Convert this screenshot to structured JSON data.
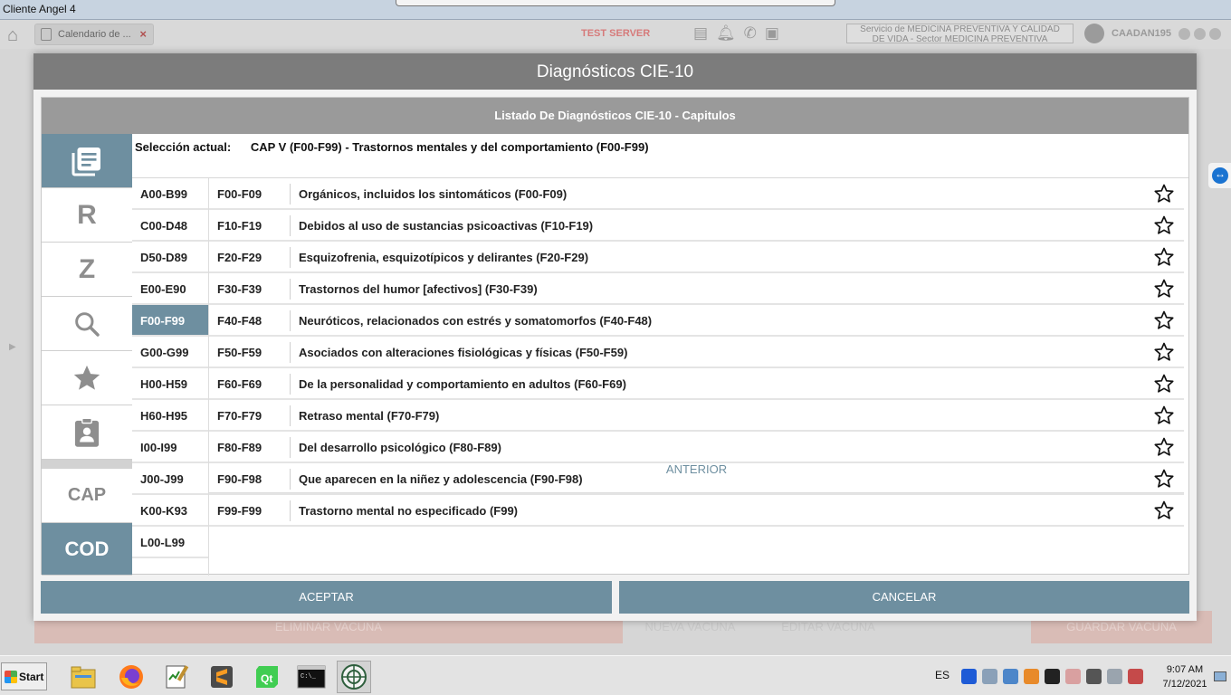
{
  "window": {
    "title": "Cliente Angel 4"
  },
  "app": {
    "tab_label": "Calendario de ...",
    "tab_close": "×",
    "server_label": "TEST SERVER",
    "service_line1": "Servicio de MEDICINA PREVENTIVA Y CALIDAD",
    "service_line2": "DE VIDA - Sector MEDICINA PREVENTIVA",
    "user": "CAADAN195",
    "bg_buttons": {
      "eliminar": "ELIMINAR VACUNA",
      "nueva": "NUEVA VACUNA",
      "editar": "EDITAR VACUNA",
      "guardar": "GUARDAR VACUNA"
    }
  },
  "dialog": {
    "title": "Diagnósticos CIE-10",
    "panel_title": "Listado De Diagnósticos CIE-10 - Capitulos",
    "selection_label": "Selección actual:",
    "selection_value": "CAP V (F00-F99) - Trastornos mentales y del comportamiento (F00-F99)",
    "side_buttons": {
      "r": "R",
      "z": "Z",
      "cap": "CAP",
      "cod": "COD"
    },
    "ranges": [
      "A00-B99",
      "C00-D48",
      "D50-D89",
      "E00-E90",
      "F00-F99",
      "G00-G99",
      "H00-H59",
      "H60-H95",
      "I00-I99",
      "J00-J99",
      "K00-K93",
      "L00-L99"
    ],
    "active_range": "F00-F99",
    "subgroups": [
      {
        "code": "F00-F09",
        "desc": "Orgánicos, incluidos los sintomáticos (F00-F09)"
      },
      {
        "code": "F10-F19",
        "desc": "Debidos al uso de sustancias psicoactivas (F10-F19)"
      },
      {
        "code": "F20-F29",
        "desc": "Esquizofrenia, esquizotípicos y delirantes (F20-F29)"
      },
      {
        "code": "F30-F39",
        "desc": "Trastornos del humor [afectivos] (F30-F39)"
      },
      {
        "code": "F40-F48",
        "desc": "Neuróticos, relacionados con estrés y somatomorfos (F40-F48)"
      },
      {
        "code": "F50-F59",
        "desc": "Asociados con alteraciones fisiológicas y físicas (F50-F59)"
      },
      {
        "code": "F60-F69",
        "desc": "De la personalidad y comportamiento en adultos (F60-F69)"
      },
      {
        "code": "F70-F79",
        "desc": "Retraso mental (F70-F79)"
      },
      {
        "code": "F80-F89",
        "desc": "Del desarrollo psicológico (F80-F89)"
      },
      {
        "code": "F90-F98",
        "desc": "Que aparecen en la niñez y adolescencia (F90-F98)"
      },
      {
        "code": "F99-F99",
        "desc": "Trastorno mental no especificado (F99)"
      }
    ],
    "anterior": "ANTERIOR",
    "accept": "ACEPTAR",
    "cancel": "CANCELAR"
  },
  "taskbar": {
    "start": "Start",
    "lang": "ES",
    "time": "9:07 AM",
    "date": "7/12/2021"
  },
  "colors": {
    "accent": "#6e8fa0",
    "title_bar": "#7c7c7c",
    "panel_header": "#9a9a9a"
  }
}
